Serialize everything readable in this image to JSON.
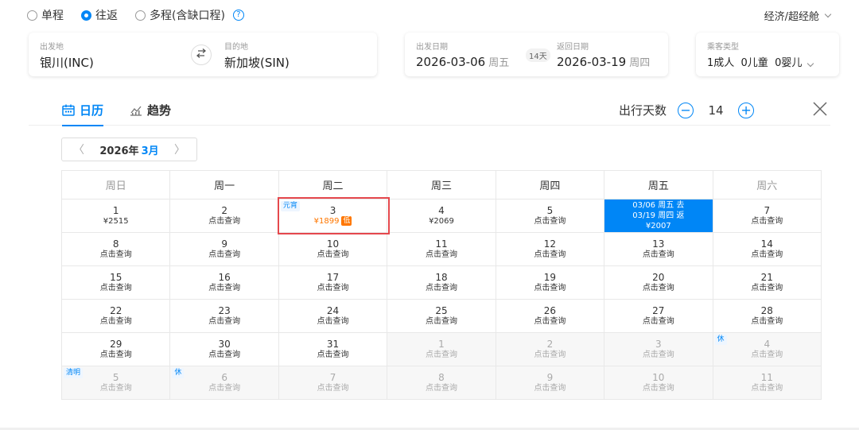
{
  "trip_types": [
    {
      "label": "单程",
      "checked": false
    },
    {
      "label": "往返",
      "checked": true
    },
    {
      "label": "多程(含缺口程)",
      "checked": false
    }
  ],
  "help_icon": "?",
  "cabin": "经济/超经舱",
  "from": {
    "label": "出发地",
    "value": "银川(INC)"
  },
  "to": {
    "label": "目的地",
    "value": "新加坡(SIN)"
  },
  "depart": {
    "label": "出发日期",
    "date": "2026-03-06",
    "weekday": "周五"
  },
  "trip_days": "14天",
  "return": {
    "label": "返回日期",
    "date": "2026-03-19",
    "weekday": "周四"
  },
  "passengers": {
    "label": "乘客类型",
    "value": "1成人  0儿童  0婴儿"
  },
  "tabs": {
    "calendar": "日历",
    "trend": "趋势"
  },
  "days_control": {
    "label": "出行天数",
    "value": "14",
    "minus": "−",
    "plus": "+"
  },
  "month_selector": {
    "prev": "〈",
    "year": "2026年",
    "month": "3月",
    "next": "〉"
  },
  "weekdays": [
    "周日",
    "周一",
    "周二",
    "周三",
    "周四",
    "周五",
    "周六"
  ],
  "calendar": {
    "rows": [
      [
        {
          "day": "1",
          "price": "¥2515"
        },
        {
          "day": "2",
          "price": "点击查询"
        },
        {
          "day": "3",
          "price": "¥1899",
          "tag": "元宵",
          "low": "低"
        },
        {
          "day": "4",
          "price": "¥2069"
        },
        {
          "day": "5",
          "price": "点击查询"
        },
        {
          "selected": [
            "03/06 周五 去",
            "03/19 周四 返",
            "¥2007"
          ]
        },
        {
          "day": "7",
          "price": "点击查询"
        }
      ],
      [
        {
          "day": "8",
          "price": "点击查询"
        },
        {
          "day": "9",
          "price": "点击查询"
        },
        {
          "day": "10",
          "price": "点击查询"
        },
        {
          "day": "11",
          "price": "点击查询"
        },
        {
          "day": "12",
          "price": "点击查询"
        },
        {
          "day": "13",
          "price": "点击查询"
        },
        {
          "day": "14",
          "price": "点击查询"
        }
      ],
      [
        {
          "day": "15",
          "price": "点击查询"
        },
        {
          "day": "16",
          "price": "点击查询"
        },
        {
          "day": "17",
          "price": "点击查询"
        },
        {
          "day": "18",
          "price": "点击查询"
        },
        {
          "day": "19",
          "price": "点击查询"
        },
        {
          "day": "20",
          "price": "点击查询"
        },
        {
          "day": "21",
          "price": "点击查询"
        }
      ],
      [
        {
          "day": "22",
          "price": "点击查询"
        },
        {
          "day": "23",
          "price": "点击查询"
        },
        {
          "day": "24",
          "price": "点击查询"
        },
        {
          "day": "25",
          "price": "点击查询"
        },
        {
          "day": "26",
          "price": "点击查询"
        },
        {
          "day": "27",
          "price": "点击查询"
        },
        {
          "day": "28",
          "price": "点击查询"
        }
      ],
      [
        {
          "day": "29",
          "price": "点击查询"
        },
        {
          "day": "30",
          "price": "点击查询"
        },
        {
          "day": "31",
          "price": "点击查询"
        },
        {
          "day": "1",
          "price": "点击查询",
          "other": true
        },
        {
          "day": "2",
          "price": "点击查询",
          "other": true
        },
        {
          "day": "3",
          "price": "点击查询",
          "other": true
        },
        {
          "day": "4",
          "price": "点击查询",
          "other": true,
          "tag": "休"
        }
      ],
      [
        {
          "day": "5",
          "price": "点击查询",
          "other": true,
          "tag": "清明"
        },
        {
          "day": "6",
          "price": "点击查询",
          "other": true,
          "tag": "休"
        },
        {
          "day": "7",
          "price": "点击查询",
          "other": true
        },
        {
          "day": "8",
          "price": "点击查询",
          "other": true
        },
        {
          "day": "9",
          "price": "点击查询",
          "other": true
        },
        {
          "day": "10",
          "price": "点击查询",
          "other": true
        },
        {
          "day": "11",
          "price": "点击查询",
          "other": true
        }
      ]
    ]
  },
  "colors": {
    "accent": "#0086f6",
    "low_price": "#ff7700",
    "highlight_box": "#e5484d"
  }
}
